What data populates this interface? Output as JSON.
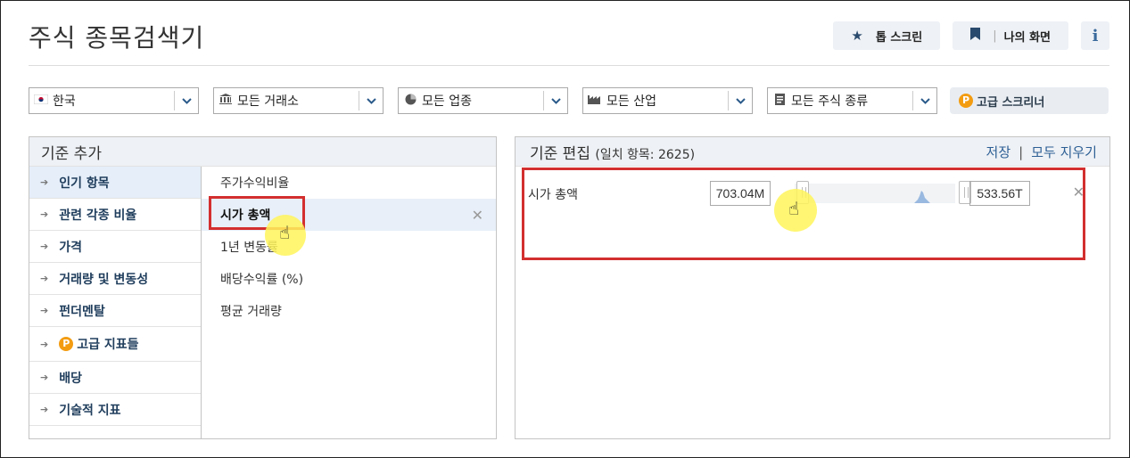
{
  "page": {
    "title": "주식 종목검색기"
  },
  "top_actions": {
    "top_screener": "톱 스크린",
    "my_screen": "나의 화면",
    "info": "i"
  },
  "filters": [
    {
      "icon": "korea-flag-icon",
      "label": "한국"
    },
    {
      "icon": "bank-icon",
      "label": "모든 거래소"
    },
    {
      "icon": "pie-icon",
      "label": "모든 업종"
    },
    {
      "icon": "factory-icon",
      "label": "모든 산업"
    },
    {
      "icon": "document-icon",
      "label": "모든 주식 종류"
    }
  ],
  "advanced_screener": {
    "badge": "P",
    "label": "고급 스크리너"
  },
  "left_panel": {
    "title": "기준 추가",
    "categories": [
      "인기 항목",
      "관련 각종 비율",
      "가격",
      "거래량 및 변동성",
      "펀더멘탈",
      "고급 지표들",
      "배당",
      "기술적 지표"
    ],
    "active_category": "인기 항목",
    "sub_items": [
      "주가수익비율",
      "시가 총액",
      "1년 변동률",
      "배당수익률 (%)",
      "평균 거래량"
    ],
    "selected_sub_item": "시가 총액"
  },
  "right_panel": {
    "title": "기준 편집",
    "match_text": "(일치 항목: 2625)",
    "save": "저장",
    "separator": "|",
    "clear_all": "모두 지우기",
    "criterion": {
      "name": "시가 총액",
      "min": "703.04M",
      "max": "533.56T"
    }
  },
  "colors": {
    "highlight_red": "#d32f2f",
    "accent_blue": "#2d5f95",
    "cursor_yellow": "#fff55a"
  }
}
